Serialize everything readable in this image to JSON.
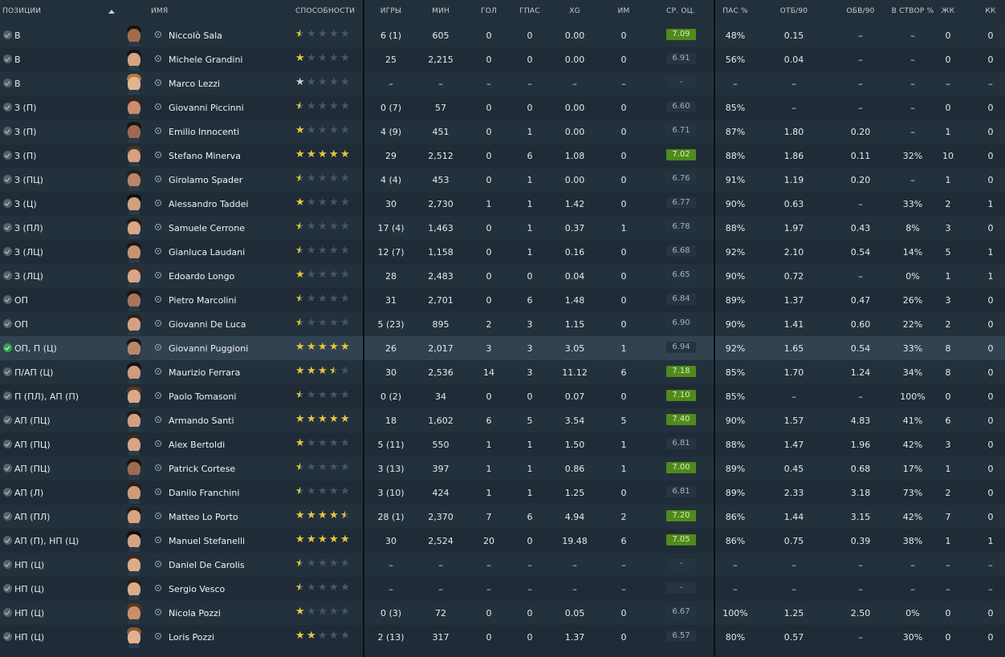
{
  "header": {
    "positions": "ПОЗИЦИИ",
    "name": "ИМЯ",
    "ability": "СПОСОБНОСТИ",
    "games": "ИГРЫ",
    "minutes": "МИН",
    "goals": "ГОЛ",
    "assists": "ГПАС",
    "xg": "XG",
    "mom": "ИМ",
    "avg_rating": "СР. ОЦ.",
    "pass_pct": "ПАС %",
    "tackles90": "ОТБ/90",
    "dribbles90": "ОБВ/90",
    "shots_on_target_pct": "В СТВОР %",
    "yellow": "ЖК",
    "red": "КК"
  },
  "colors": {
    "rating_green": "#4f8a1a",
    "star_gold": "#e9c63a",
    "star_grey": "#c8ced4",
    "check_green": "#2fa24e"
  },
  "rows": [
    {
      "pos": "В",
      "name": "Niccolò Sala",
      "stars": 1,
      "stars_color": "gold",
      "games": "6 (1)",
      "min": "605",
      "gls": "0",
      "ast": "0",
      "xg": "0.00",
      "mom": "0",
      "rating": "7.09",
      "rating_green": true,
      "pas": "48%",
      "tck": "0.15",
      "drb": "–",
      "sot": "–",
      "yc": "0",
      "rc": "0",
      "skin": "#a06d4c",
      "hair": "#1a1410"
    },
    {
      "pos": "В",
      "name": "Michele Grandini",
      "stars": 2,
      "stars_color": "gold",
      "games": "25",
      "min": "2,215",
      "gls": "0",
      "ast": "0",
      "xg": "0.00",
      "mom": "0",
      "rating": "6.91",
      "rating_green": false,
      "pas": "56%",
      "tck": "0.04",
      "drb": "–",
      "sot": "–",
      "yc": "0",
      "rc": "0",
      "skin": "#d6a384",
      "hair": "#151515"
    },
    {
      "pos": "В",
      "name": "Marco Lezzi",
      "stars": 2,
      "stars_color": "grey",
      "games": "–",
      "min": "–",
      "gls": "–",
      "ast": "–",
      "xg": "–",
      "mom": "–",
      "rating": "-",
      "rating_green": false,
      "pas": "–",
      "tck": "–",
      "drb": "–",
      "sot": "–",
      "yc": "–",
      "rc": "–",
      "skin": "#e2b48f",
      "hair": "#b07b42"
    },
    {
      "pos": "З (П)",
      "name": "Giovanni Piccinni",
      "stars": 1,
      "stars_color": "gold",
      "games": "0 (7)",
      "min": "57",
      "gls": "0",
      "ast": "0",
      "xg": "0.00",
      "mom": "0",
      "rating": "6.60",
      "rating_green": false,
      "pas": "85%",
      "tck": "–",
      "drb": "–",
      "sot": "–",
      "yc": "0",
      "rc": "0",
      "skin": "#c98e6b",
      "hair": "#3a2518"
    },
    {
      "pos": "З (П)",
      "name": "Emilio Innocenti",
      "stars": 2,
      "stars_color": "gold",
      "games": "4 (9)",
      "min": "451",
      "gls": "0",
      "ast": "1",
      "xg": "0.00",
      "mom": "0",
      "rating": "6.71",
      "rating_green": false,
      "pas": "87%",
      "tck": "1.80",
      "drb": "0.20",
      "sot": "–",
      "yc": "1",
      "rc": "0",
      "skin": "#9b6a4f",
      "hair": "#18120e"
    },
    {
      "pos": "З (П)",
      "name": "Stefano Minerva",
      "stars": 10,
      "stars_color": "gold",
      "games": "29",
      "min": "2,512",
      "gls": "0",
      "ast": "6",
      "xg": "1.08",
      "mom": "0",
      "rating": "7.02",
      "rating_green": true,
      "pas": "88%",
      "tck": "1.86",
      "drb": "0.11",
      "sot": "32%",
      "yc": "10",
      "rc": "0",
      "skin": "#d7a180",
      "hair": "#4a321d"
    },
    {
      "pos": "З (ПЦ)",
      "name": "Girolamo Spader",
      "stars": 1,
      "stars_color": "gold",
      "games": "4 (4)",
      "min": "453",
      "gls": "0",
      "ast": "1",
      "xg": "0.00",
      "mom": "0",
      "rating": "6.76",
      "rating_green": false,
      "pas": "91%",
      "tck": "1.19",
      "drb": "0.20",
      "sot": "–",
      "yc": "1",
      "rc": "0",
      "skin": "#b6866a",
      "hair": "#2a1f17"
    },
    {
      "pos": "З (Ц)",
      "name": "Alessandro Taddei",
      "stars": 2,
      "stars_color": "gold",
      "games": "30",
      "min": "2,730",
      "gls": "1",
      "ast": "1",
      "xg": "1.42",
      "mom": "0",
      "rating": "6.77",
      "rating_green": false,
      "pas": "90%",
      "tck": "0.63",
      "drb": "–",
      "sot": "33%",
      "yc": "2",
      "rc": "1",
      "skin": "#d1a07f",
      "hair": "#101010"
    },
    {
      "pos": "З (ПЛ)",
      "name": "Samuele Cerrone",
      "stars": 1,
      "stars_color": "gold",
      "games": "17 (4)",
      "min": "1,463",
      "gls": "0",
      "ast": "1",
      "xg": "0.37",
      "mom": "1",
      "rating": "6.78",
      "rating_green": false,
      "pas": "88%",
      "tck": "1.97",
      "drb": "0.43",
      "sot": "8%",
      "yc": "3",
      "rc": "0",
      "skin": "#d8a887",
      "hair": "#241a14"
    },
    {
      "pos": "З (ЛЦ)",
      "name": "Gianluca Laudani",
      "stars": 1,
      "stars_color": "gold",
      "games": "12 (7)",
      "min": "1,158",
      "gls": "0",
      "ast": "1",
      "xg": "0.16",
      "mom": "0",
      "rating": "6.68",
      "rating_green": false,
      "pas": "92%",
      "tck": "2.10",
      "drb": "0.54",
      "sot": "14%",
      "yc": "5",
      "rc": "1",
      "skin": "#c79473",
      "hair": "#1e1712"
    },
    {
      "pos": "З (ЛЦ)",
      "name": "Edoardo Longo",
      "stars": 2,
      "stars_color": "gold",
      "games": "28",
      "min": "2,483",
      "gls": "0",
      "ast": "0",
      "xg": "0.04",
      "mom": "0",
      "rating": "6.65",
      "rating_green": false,
      "pas": "90%",
      "tck": "0.72",
      "drb": "–",
      "sot": "0%",
      "yc": "1",
      "rc": "1",
      "skin": "#d9a787",
      "hair": "#3b2a1c"
    },
    {
      "pos": "ОП",
      "name": "Pietro Marcolini",
      "stars": 1,
      "stars_color": "gold",
      "games": "31",
      "min": "2,701",
      "gls": "0",
      "ast": "6",
      "xg": "1.48",
      "mom": "0",
      "rating": "6.84",
      "rating_green": false,
      "pas": "89%",
      "tck": "1.37",
      "drb": "0.47",
      "sot": "26%",
      "yc": "3",
      "rc": "0",
      "skin": "#a8765a",
      "hair": "#1b1410"
    },
    {
      "pos": "ОП",
      "name": "Giovanni De Luca",
      "stars": 1,
      "stars_color": "gold",
      "games": "5 (23)",
      "min": "895",
      "gls": "2",
      "ast": "3",
      "xg": "1.15",
      "mom": "0",
      "rating": "6.90",
      "rating_green": false,
      "pas": "90%",
      "tck": "1.41",
      "drb": "0.60",
      "sot": "22%",
      "yc": "2",
      "rc": "0",
      "skin": "#d4a282",
      "hair": "#2c2016"
    },
    {
      "pos": "ОП, П (Ц)",
      "name": "Giovanni Puggioni",
      "stars": 10,
      "stars_color": "gold",
      "games": "26",
      "min": "2,017",
      "gls": "3",
      "ast": "3",
      "xg": "3.05",
      "mom": "1",
      "rating": "6.94",
      "rating_green": false,
      "pas": "92%",
      "tck": "1.65",
      "drb": "0.54",
      "sot": "33%",
      "yc": "8",
      "rc": "0",
      "skin": "#b8876b",
      "hair": "#1c1612",
      "selected": true
    },
    {
      "pos": "П/АП (Ц)",
      "name": "Maurizio Ferrara",
      "stars": 7,
      "stars_color": "gold",
      "games": "30",
      "min": "2,536",
      "gls": "14",
      "ast": "3",
      "xg": "11.12",
      "mom": "6",
      "rating": "7.18",
      "rating_green": true,
      "pas": "85%",
      "tck": "1.70",
      "drb": "1.24",
      "sot": "34%",
      "yc": "8",
      "rc": "0",
      "skin": "#cf9c7c",
      "hair": "#141414"
    },
    {
      "pos": "П (ПЛ), АП (П)",
      "name": "Paolo Tomasoni",
      "stars": 1,
      "stars_color": "gold",
      "games": "0 (2)",
      "min": "34",
      "gls": "0",
      "ast": "0",
      "xg": "0.07",
      "mom": "0",
      "rating": "7.10",
      "rating_green": true,
      "pas": "85%",
      "tck": "–",
      "drb": "–",
      "sot": "100%",
      "yc": "0",
      "rc": "0",
      "skin": "#d9a989",
      "hair": "#5a3b22"
    },
    {
      "pos": "АП (ПЦ)",
      "name": "Armando Santi",
      "stars": 10,
      "stars_color": "gold",
      "games": "18",
      "min": "1,602",
      "gls": "6",
      "ast": "5",
      "xg": "3.54",
      "mom": "5",
      "rating": "7.40",
      "rating_green": true,
      "pas": "90%",
      "tck": "1.57",
      "drb": "4.83",
      "sot": "41%",
      "yc": "6",
      "rc": "0",
      "skin": "#d2a080",
      "hair": "#231a13"
    },
    {
      "pos": "АП (ПЦ)",
      "name": "Alex Bertoldi",
      "stars": 2,
      "stars_color": "gold",
      "games": "5 (11)",
      "min": "550",
      "gls": "1",
      "ast": "1",
      "xg": "1.50",
      "mom": "1",
      "rating": "6.81",
      "rating_green": false,
      "pas": "88%",
      "tck": "1.47",
      "drb": "1.96",
      "sot": "42%",
      "yc": "3",
      "rc": "0",
      "skin": "#d6a686",
      "hair": "#3e2b1b"
    },
    {
      "pos": "АП (ПЦ)",
      "name": "Patrick Cortese",
      "stars": 1,
      "stars_color": "gold",
      "games": "3 (13)",
      "min": "397",
      "gls": "1",
      "ast": "1",
      "xg": "0.86",
      "mom": "1",
      "rating": "7.00",
      "rating_green": true,
      "pas": "89%",
      "tck": "0.45",
      "drb": "0.68",
      "sot": "17%",
      "yc": "1",
      "rc": "0",
      "skin": "#9c6c52",
      "hair": "#1a130e"
    },
    {
      "pos": "АП (Л)",
      "name": "Danilo Franchini",
      "stars": 1,
      "stars_color": "gold",
      "games": "3 (10)",
      "min": "424",
      "gls": "1",
      "ast": "1",
      "xg": "1.25",
      "mom": "0",
      "rating": "6.81",
      "rating_green": false,
      "pas": "89%",
      "tck": "2.33",
      "drb": "3.18",
      "sot": "73%",
      "yc": "2",
      "rc": "0",
      "skin": "#cf9b7b",
      "hair": "#2b2017"
    },
    {
      "pos": "АП (ПЛ)",
      "name": "Matteo Lo Porto",
      "stars": 9,
      "stars_color": "gold",
      "games": "28 (1)",
      "min": "2,370",
      "gls": "7",
      "ast": "6",
      "xg": "4.94",
      "mom": "2",
      "rating": "7.20",
      "rating_green": true,
      "pas": "86%",
      "tck": "1.44",
      "drb": "3.15",
      "sot": "42%",
      "yc": "7",
      "rc": "0",
      "skin": "#d7a584",
      "hair": "#241b14"
    },
    {
      "pos": "АП (П), НП (Ц)",
      "name": "Manuel Stefanelli",
      "stars": 10,
      "stars_color": "gold",
      "games": "30",
      "min": "2,524",
      "gls": "20",
      "ast": "0",
      "xg": "19.48",
      "mom": "6",
      "rating": "7.05",
      "rating_green": true,
      "pas": "86%",
      "tck": "0.75",
      "drb": "0.39",
      "sot": "38%",
      "yc": "1",
      "rc": "1",
      "skin": "#d3a382",
      "hair": "#0f0f0f"
    },
    {
      "pos": "НП (Ц)",
      "name": "Daniel De Carolis",
      "stars": 1,
      "stars_color": "gold",
      "games": "–",
      "min": "–",
      "gls": "–",
      "ast": "–",
      "xg": "–",
      "mom": "–",
      "rating": "-",
      "rating_green": false,
      "pas": "–",
      "tck": "–",
      "drb": "–",
      "sot": "–",
      "yc": "–",
      "rc": "–",
      "skin": "#dcac8c",
      "hair": "#3c2a1c"
    },
    {
      "pos": "НП (Ц)",
      "name": "Sergio Vesco",
      "stars": 1,
      "stars_color": "gold",
      "games": "–",
      "min": "–",
      "gls": "–",
      "ast": "–",
      "xg": "–",
      "mom": "–",
      "rating": "-",
      "rating_green": false,
      "pas": "–",
      "tck": "–",
      "drb": "–",
      "sot": "–",
      "yc": "–",
      "rc": "–",
      "skin": "#dbab8a",
      "hair": "#2a1f16"
    },
    {
      "pos": "НП (Ц)",
      "name": "Nicola Pozzi",
      "stars": 2,
      "stars_color": "gold",
      "games": "0 (3)",
      "min": "72",
      "gls": "0",
      "ast": "0",
      "xg": "0.05",
      "mom": "0",
      "rating": "6.67",
      "rating_green": false,
      "pas": "100%",
      "tck": "1.25",
      "drb": "2.50",
      "sot": "0%",
      "yc": "0",
      "rc": "0",
      "skin": "#c8906c",
      "hair": "#5a3820"
    },
    {
      "pos": "НП (Ц)",
      "name": "Loris Pozzi",
      "stars": 4,
      "stars_color": "gold",
      "games": "2 (13)",
      "min": "317",
      "gls": "0",
      "ast": "0",
      "xg": "1.37",
      "mom": "0",
      "rating": "6.57",
      "rating_green": false,
      "pas": "80%",
      "tck": "0.57",
      "drb": "–",
      "sot": "30%",
      "yc": "0",
      "rc": "0",
      "skin": "#e0b191",
      "hair": "#8a5a30"
    }
  ]
}
